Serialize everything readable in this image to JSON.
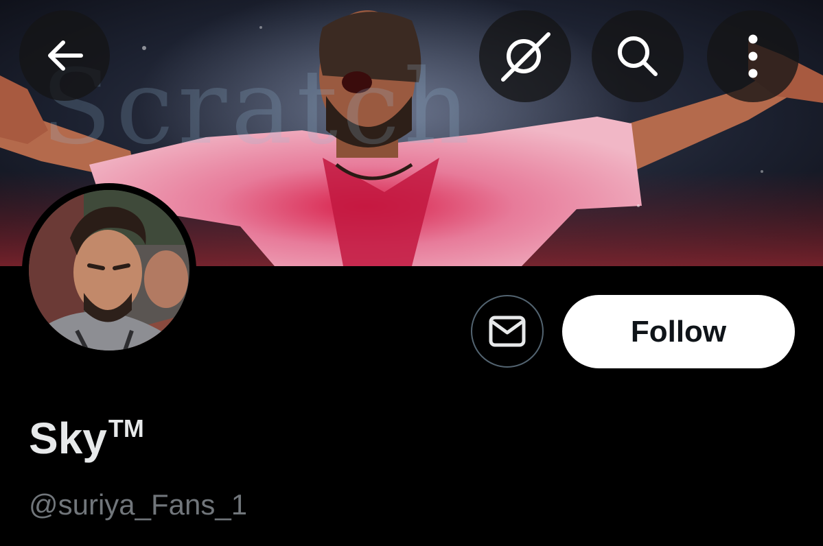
{
  "banner": {
    "watermark_text": "Scratch",
    "description_icon": "banner-image"
  },
  "top_bar": {
    "back_icon": "arrow-left-icon",
    "grok_icon": "grok-icon",
    "search_icon": "search-icon",
    "more_icon": "more-vertical-icon"
  },
  "profile": {
    "display_name": "Sky",
    "display_name_suffix": "TM",
    "handle": "@suriya_Fans_1"
  },
  "actions": {
    "message_icon": "envelope-icon",
    "follow_label": "Follow"
  },
  "colors": {
    "background": "#000000",
    "name_text": "#e7e9ea",
    "handle_text": "#71767b",
    "follow_bg": "#ffffff",
    "follow_text": "#0f1419",
    "outline": "#536471"
  }
}
